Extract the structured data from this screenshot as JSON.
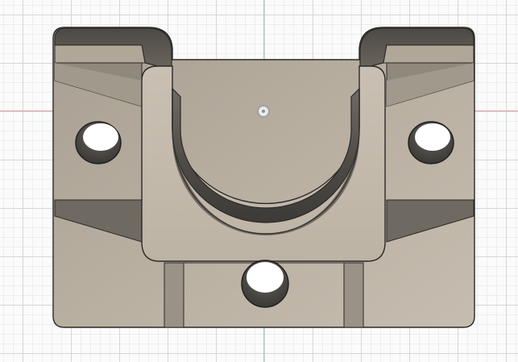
{
  "viewport": {
    "background": "#fbfbfb",
    "grid_major_color": "#d3d6d8",
    "grid_minor_color": "#eceeef"
  },
  "axes": {
    "x_axis_color": "#e8a3a3",
    "y_axis_color": "#9fd8a8"
  },
  "model": {
    "body_color": "#b4ab9d",
    "face_color": "#c2b8aa",
    "shadow_color": "#5f5b55",
    "edge_color": "#2b2a28",
    "hole_color": "#4b4945"
  },
  "icons": {
    "origin": "origin-point-icon"
  }
}
